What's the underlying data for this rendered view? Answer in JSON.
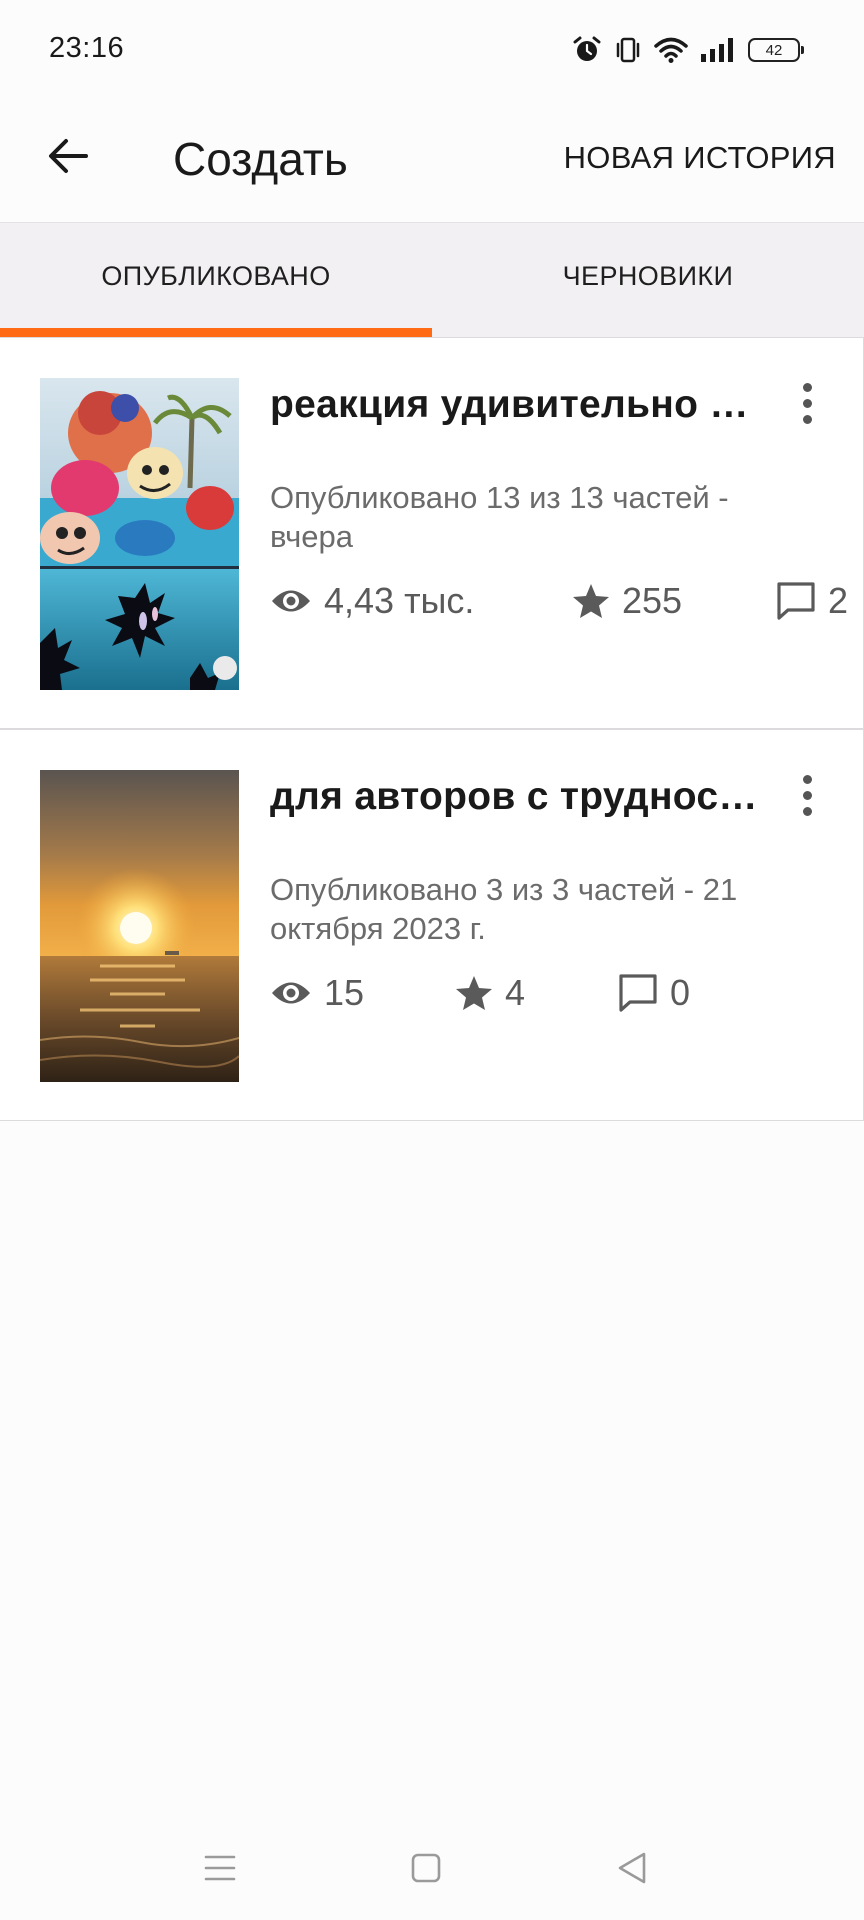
{
  "status_bar": {
    "time": "23:16",
    "battery_level": "42",
    "icons": [
      "alarm-icon",
      "vibrate-icon",
      "wifi-icon",
      "signal-icon",
      "battery-icon"
    ]
  },
  "app_bar": {
    "back_icon": "arrow-left-icon",
    "title": "Создать",
    "new_story_label": "НОВАЯ ИСТОРИЯ"
  },
  "tabs": {
    "published_label": "ОПУБЛИКОВАНО",
    "drafts_label": "ЧЕРНОВИКИ",
    "active": "published",
    "accent_color": "#ff6a14"
  },
  "stories": [
    {
      "title": "реакция удивительно …",
      "status": "Опубликовано 13 из 13 частей - вчера",
      "views": "4,43 тыс.",
      "votes": "255",
      "comments": "2"
    },
    {
      "title": "для авторов с труднос…",
      "status": "Опубликовано 3 из 3 частей - 21 октября 2023 г.",
      "views": "15",
      "votes": "4",
      "comments": "0"
    }
  ],
  "nav_bar": {
    "icons": [
      "menu-icon",
      "home-icon",
      "back-triangle-icon"
    ]
  }
}
